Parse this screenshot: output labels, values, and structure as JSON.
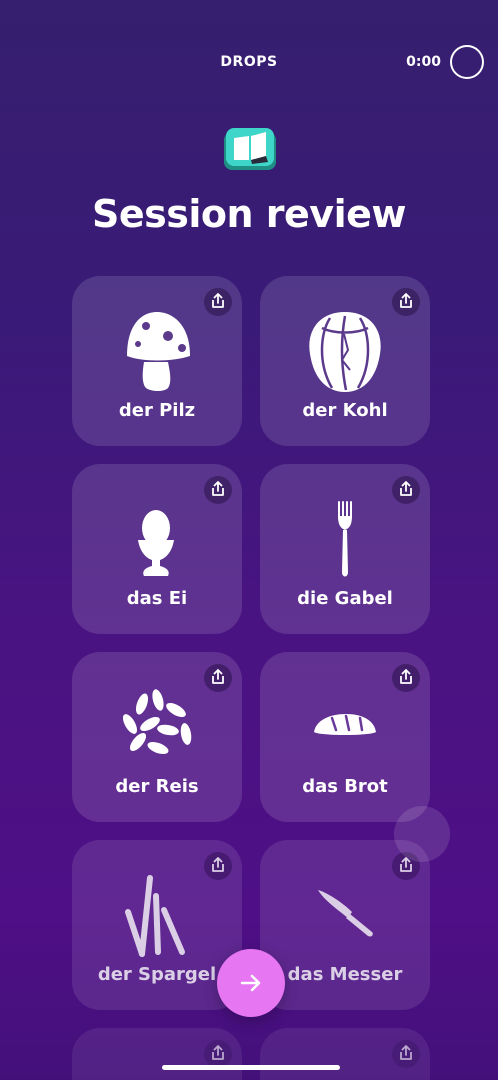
{
  "header": {
    "app_title": "DROPS",
    "timer": "0:00"
  },
  "page": {
    "title": "Session review"
  },
  "words": [
    {
      "label": "der Pilz",
      "icon": "mushroom-icon"
    },
    {
      "label": "der Kohl",
      "icon": "cabbage-icon"
    },
    {
      "label": "das Ei",
      "icon": "egg-icon"
    },
    {
      "label": "die Gabel",
      "icon": "fork-icon"
    },
    {
      "label": "der Reis",
      "icon": "rice-icon"
    },
    {
      "label": "das Brot",
      "icon": "bread-icon"
    },
    {
      "label": "der Spargel",
      "icon": "asparagus-icon"
    },
    {
      "label": "das Messer",
      "icon": "knife-icon"
    }
  ],
  "colors": {
    "accent_button": "#e676f2",
    "book_icon": "#3ed6c8"
  }
}
